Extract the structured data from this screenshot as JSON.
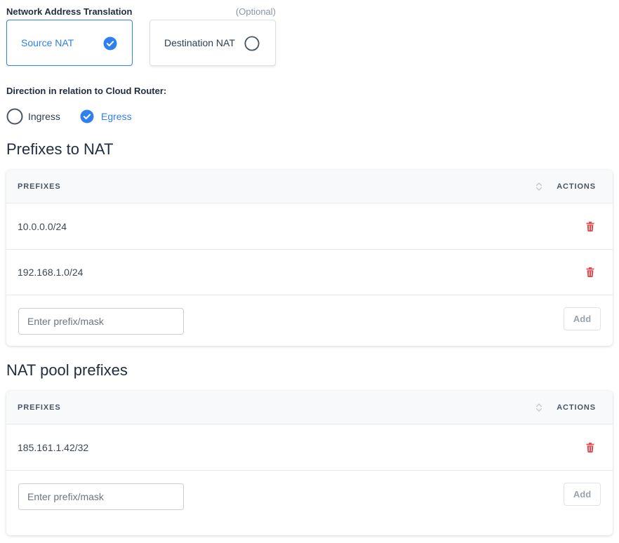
{
  "nat": {
    "title": "Network Address Translation",
    "optional": "(Optional)",
    "options": [
      {
        "label": "Source NAT",
        "selected": true
      },
      {
        "label": "Destination NAT",
        "selected": false
      }
    ]
  },
  "direction": {
    "label": "Direction in relation to Cloud Router:",
    "options": [
      {
        "label": "Ingress",
        "selected": false
      },
      {
        "label": "Egress",
        "selected": true
      }
    ]
  },
  "prefixes_to_nat": {
    "title": "Prefixes to NAT",
    "columns": {
      "prefixes": "PREFIXES",
      "actions": "ACTIONS"
    },
    "rows": [
      "10.0.0.0/24",
      "192.168.1.0/24"
    ],
    "input_placeholder": "Enter prefix/mask",
    "add_label": "Add"
  },
  "nat_pool_prefixes": {
    "title": "NAT pool prefixes",
    "columns": {
      "prefixes": "PREFIXES",
      "actions": "ACTIONS"
    },
    "rows": [
      "185.161.1.42/32"
    ],
    "input_placeholder": "Enter prefix/mask",
    "add_label": "Add"
  },
  "colors": {
    "accent": "#2f80ed",
    "delete": "#e5484d",
    "radio_off": "#4a5563"
  }
}
